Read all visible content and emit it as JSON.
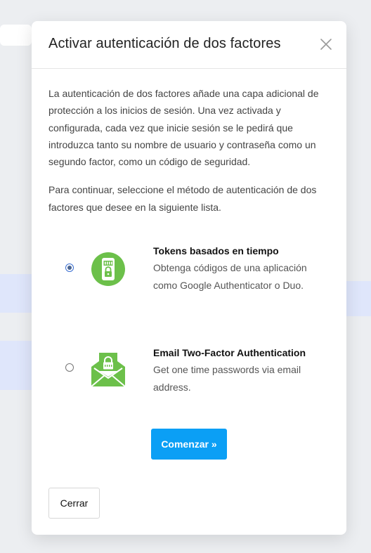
{
  "modal": {
    "title": "Activar autenticación de dos factores",
    "description": "La autenticación de dos factores añade una capa adicional de protección a los inicios de sesión. Una vez activada y configurada, cada vez que inicie sesión se le pedirá que introduzca tanto su nombre de usuario y contraseña como un segundo factor, como un código de seguridad.",
    "instruction": "Para continuar, seleccione el método de autenticación de dos factores que desee en la siguiente lista.",
    "options": [
      {
        "title": "Tokens basados en tiempo",
        "description": "Obtenga códigos de una aplicación como Google Authenticator o Duo.",
        "selected": true,
        "icon": "phone-lock-icon"
      },
      {
        "title": "Email Two-Factor Authentication",
        "description": "Get one time passwords via email address.",
        "selected": false,
        "icon": "envelope-lock-icon"
      }
    ],
    "start_label": "Comenzar »",
    "close_label": "Cerrar"
  },
  "colors": {
    "accent": "#0b9ff5",
    "icon_green": "#6cc04a"
  }
}
